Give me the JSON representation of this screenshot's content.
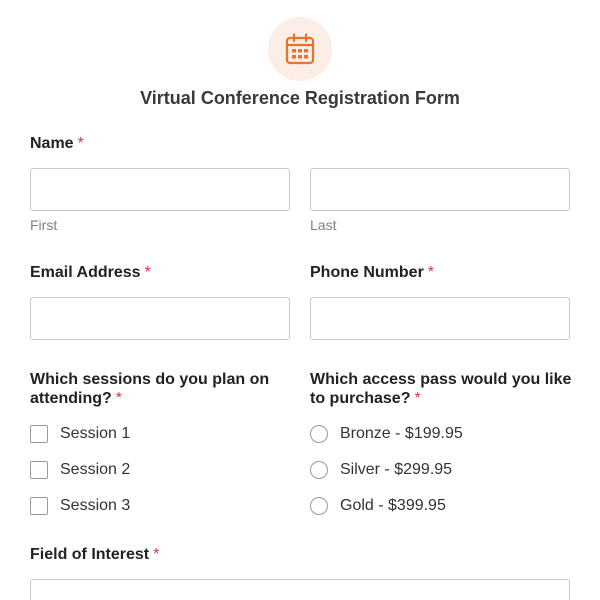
{
  "header": {
    "icon": "calendar-icon",
    "accent_color": "#e8732c",
    "title": "Virtual Conference Registration Form"
  },
  "required_marker": "*",
  "name": {
    "label": "Name",
    "first_sublabel": "First",
    "last_sublabel": "Last",
    "first_value": "",
    "last_value": ""
  },
  "email": {
    "label": "Email Address",
    "value": ""
  },
  "phone": {
    "label": "Phone Number",
    "value": ""
  },
  "sessions": {
    "label_line1": "Which sessions do you plan on",
    "label_line2": "attending?",
    "options": [
      {
        "label": "Session 1",
        "checked": false
      },
      {
        "label": "Session 2",
        "checked": false
      },
      {
        "label": "Session 3",
        "checked": false
      }
    ]
  },
  "pass": {
    "label_line1": "Which access pass would you like",
    "label_line2": "to purchase?",
    "options": [
      {
        "label": "Bronze - $199.95",
        "selected": false
      },
      {
        "label": "Silver - $299.95",
        "selected": false
      },
      {
        "label": "Gold - $399.95",
        "selected": false
      }
    ]
  },
  "interest": {
    "label": "Field of Interest",
    "value": ""
  }
}
